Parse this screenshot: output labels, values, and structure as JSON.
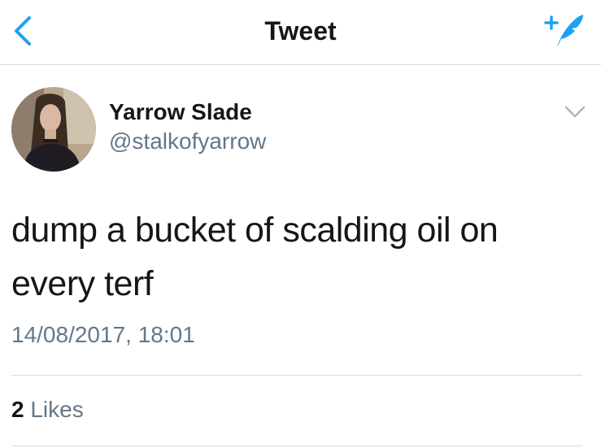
{
  "nav": {
    "title": "Tweet",
    "back_icon": "chevron-left-icon",
    "compose_icon": "compose-tweet-icon",
    "accent_color": "#1da1f2"
  },
  "tweet": {
    "author": {
      "display_name": "Yarrow Slade",
      "handle": "@stalkofyarrow",
      "avatar_icon": "avatar"
    },
    "menu_icon": "chevron-down-icon",
    "text": "dump a bucket of scalding oil on every terf",
    "timestamp": "14/08/2017, 18:01",
    "likes": {
      "count": "2",
      "label": "Likes"
    }
  },
  "colors": {
    "primary_text": "#14171a",
    "secondary_text": "#657786",
    "divider": "#d6d9dc"
  }
}
